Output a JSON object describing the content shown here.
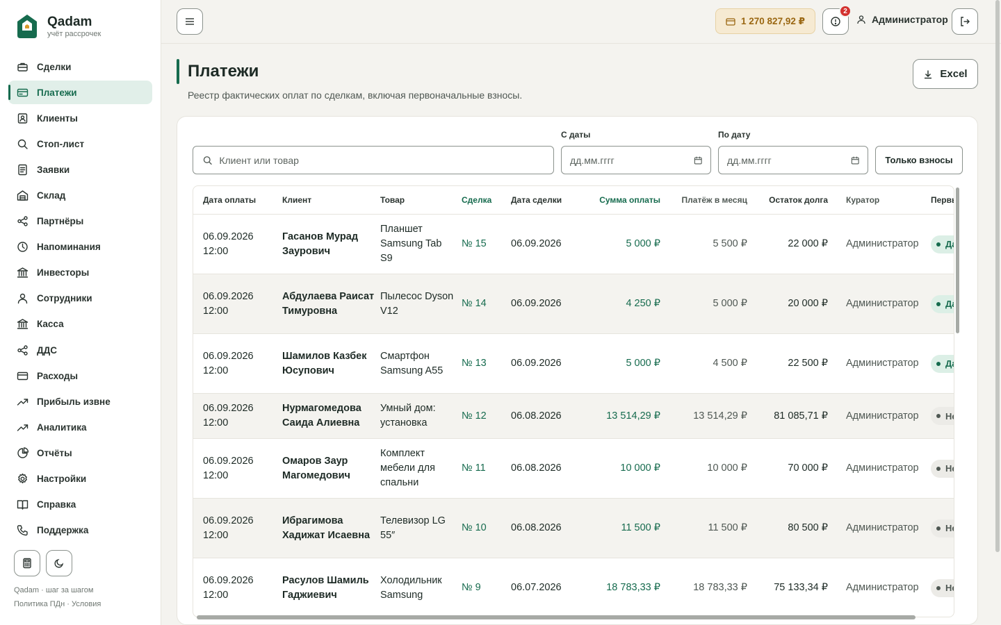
{
  "brand": {
    "name": "Qadam",
    "subtitle": "учёт рассрочек"
  },
  "nav": [
    {
      "label": "Сделки",
      "icon": "briefcase-icon",
      "active": false
    },
    {
      "label": "Платежи",
      "icon": "credit-card-icon",
      "active": true
    },
    {
      "label": "Клиенты",
      "icon": "contact-icon",
      "active": false
    },
    {
      "label": "Стоп-лист",
      "icon": "search-icon",
      "active": false
    },
    {
      "label": "Заявки",
      "icon": "document-icon",
      "active": false
    },
    {
      "label": "Склад",
      "icon": "warehouse-icon",
      "active": false
    },
    {
      "label": "Партнёры",
      "icon": "share-icon",
      "active": false
    },
    {
      "label": "Напоминания",
      "icon": "clock-icon",
      "active": false
    },
    {
      "label": "Инвесторы",
      "icon": "bank-icon",
      "active": false
    },
    {
      "label": "Сотрудники",
      "icon": "user-icon",
      "active": false
    },
    {
      "label": "Касса",
      "icon": "bank-icon",
      "active": false
    },
    {
      "label": "ДДС",
      "icon": "share-icon",
      "active": false
    },
    {
      "label": "Расходы",
      "icon": "wallet-icon",
      "active": false
    },
    {
      "label": "Прибыль извне",
      "icon": "trend-up-icon",
      "active": false
    },
    {
      "label": "Аналитика",
      "icon": "trend-up-icon",
      "active": false
    },
    {
      "label": "Отчёты",
      "icon": "pie-chart-icon",
      "active": false
    },
    {
      "label": "Настройки",
      "icon": "gear-icon",
      "active": false
    },
    {
      "label": "Справка",
      "icon": "book-icon",
      "active": false
    },
    {
      "label": "Поддержка",
      "icon": "phone-icon",
      "active": false
    }
  ],
  "footer": {
    "line1": "Qadam · шаг за шагом",
    "line2": "Политика ПДн · Условия"
  },
  "topbar": {
    "balance": "1 270 827,92 ₽",
    "alerts_count": "2",
    "user": "Администратор"
  },
  "page": {
    "title": "Платежи",
    "subtitle": "Реестр фактических оплат по сделкам, включая первоначальные взносы.",
    "excel_label": "Excel"
  },
  "filters": {
    "search_placeholder": "Клиент или товар",
    "date_from_label": "С даты",
    "date_to_label": "По дату",
    "date_placeholder": "дд.мм.гггг",
    "only_down_label": "Только взносы"
  },
  "table": {
    "headers": [
      "Дата оплаты",
      "Клиент",
      "Товар",
      "Сделка",
      "Дата сделки",
      "Сумма оплаты",
      "Платёж в месяц",
      "Остаток долга",
      "Куратор",
      "Первы"
    ],
    "rows": [
      {
        "date": "06.09.2026 12:00",
        "client": "Гасанов Мурад Заурович",
        "product": "Планшет Samsung Tab S9",
        "deal": "№ 15",
        "deal_date": "06.09.2026",
        "amount": "5 000 ₽",
        "monthly": "5 500 ₽",
        "debt": "22 000 ₽",
        "curator": "Администратор",
        "first": "Да",
        "first_yes": true,
        "h": 86
      },
      {
        "date": "06.09.2026 12:00",
        "client": "Абдулаева Раисат Тимуровна",
        "product": "Пылесос Dyson V12",
        "deal": "№ 14",
        "deal_date": "06.09.2026",
        "amount": "4 250 ₽",
        "monthly": "5 000 ₽",
        "debt": "20 000 ₽",
        "curator": "Администратор",
        "first": "Да",
        "first_yes": true,
        "h": 86
      },
      {
        "date": "06.09.2026 12:00",
        "client": "Шамилов Казбек Юсупович",
        "product": "Смартфон Samsung A55",
        "deal": "№ 13",
        "deal_date": "06.09.2026",
        "amount": "5 000 ₽",
        "monthly": "4 500 ₽",
        "debt": "22 500 ₽",
        "curator": "Администратор",
        "first": "Да",
        "first_yes": true,
        "h": 86
      },
      {
        "date": "06.09.2026 12:00",
        "client": "Нурмагомедова Саида Алиевна",
        "product": "Умный дом: установка",
        "deal": "№ 12",
        "deal_date": "06.08.2026",
        "amount": "13 514,29 ₽",
        "monthly": "13 514,29 ₽",
        "debt": "81 085,71 ₽",
        "curator": "Администратор",
        "first": "Нет",
        "first_yes": false,
        "h": 65
      },
      {
        "date": "06.09.2026 12:00",
        "client": "Омаров Заур Магомедович",
        "product": "Комплект мебели для спальни",
        "deal": "№ 11",
        "deal_date": "06.08.2026",
        "amount": "10 000 ₽",
        "monthly": "10 000 ₽",
        "debt": "70 000 ₽",
        "curator": "Администратор",
        "first": "Нет",
        "first_yes": false,
        "h": 86
      },
      {
        "date": "06.09.2026 12:00",
        "client": "Ибрагимова Хадижат Исаевна",
        "product": "Телевизор LG 55″",
        "deal": "№ 10",
        "deal_date": "06.08.2026",
        "amount": "11 500 ₽",
        "monthly": "11 500 ₽",
        "debt": "80 500 ₽",
        "curator": "Администратор",
        "first": "Нет",
        "first_yes": false,
        "h": 86
      },
      {
        "date": "06.09.2026 12:00",
        "client": "Расулов Шамиль Гаджиевич",
        "product": "Холодильник Samsung",
        "deal": "№ 9",
        "deal_date": "06.07.2026",
        "amount": "18 783,33 ₽",
        "monthly": "18 783,33 ₽",
        "debt": "75 133,34 ₽",
        "curator": "Администратор",
        "first": "Нет",
        "first_yes": false,
        "h": 86
      }
    ]
  }
}
